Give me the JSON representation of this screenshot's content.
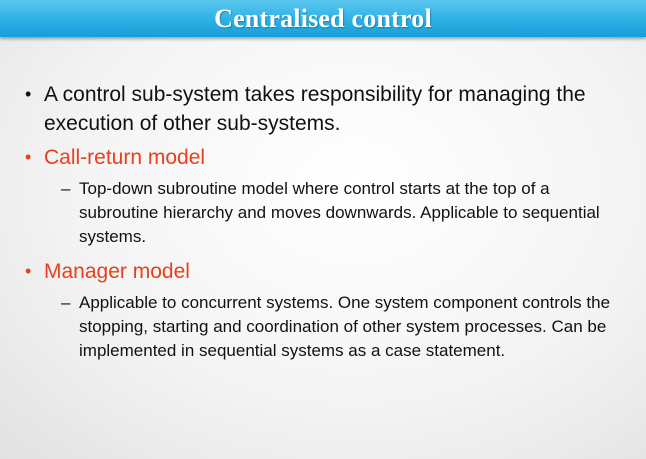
{
  "slide": {
    "title": "Centralised control",
    "bullets": [
      {
        "text": "A control sub-system takes responsibility for managing the execution of other sub-systems."
      },
      {
        "text": "Call-return model",
        "sub": "Top-down subroutine model where control starts at the top of a subroutine hierarchy and moves downwards. Applicable to sequential systems."
      },
      {
        "text": "Manager model",
        "sub": "Applicable to concurrent systems. One system component controls the stopping, starting and coordination of other system processes. Can be implemented in sequential systems as a case statement."
      }
    ]
  },
  "colors": {
    "title_bar": "#2fb2e6",
    "accent": "#e8401c",
    "text": "#111111"
  }
}
